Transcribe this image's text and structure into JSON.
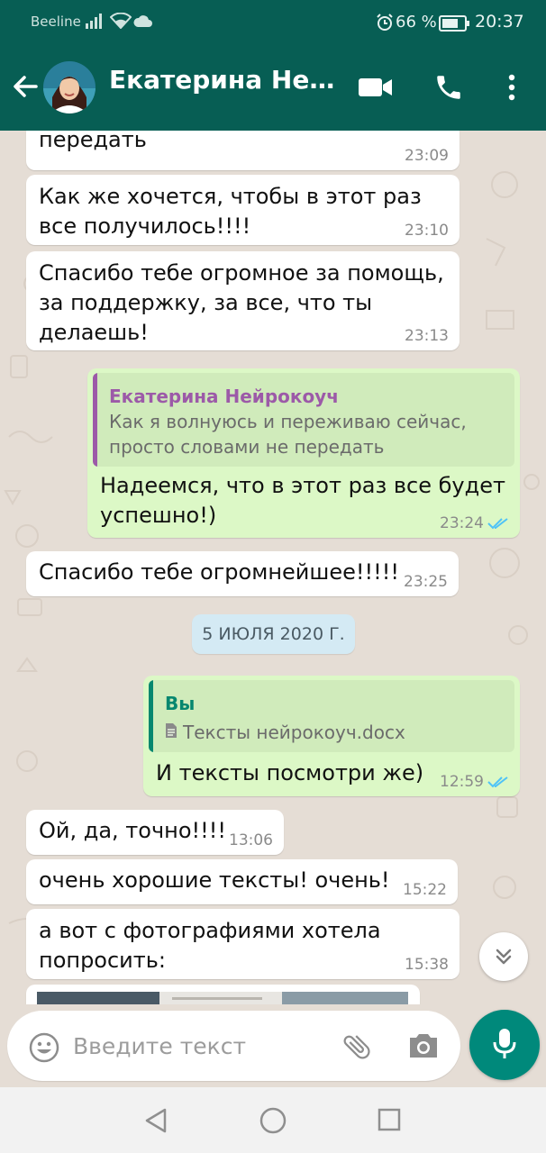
{
  "status_bar": {
    "carrier": "Beeline",
    "battery_percent": "66 %",
    "time": "20:37"
  },
  "header": {
    "contact_name": "Екатерина Нейрокоуч",
    "icons": [
      "back-arrow-icon",
      "video-call-icon",
      "phone-icon",
      "more-vert-icon"
    ]
  },
  "messages": [
    {
      "text": "передать",
      "time": "23:09",
      "direction": "in"
    },
    {
      "text": "Как же хочется, чтобы в этот раз\nвсе получилось!!!!",
      "time": "23:10",
      "direction": "in"
    },
    {
      "text": "Спасибо тебе огромное за помощь,\nза поддержку, за все, что ты\nделаешь!",
      "time": "23:13",
      "direction": "in"
    },
    {
      "direction": "out",
      "quote": {
        "author": "Екатерина Нейрокоуч",
        "text": "Как я волнуюсь и переживаю сейчас,\nпросто словами не передать",
        "color": "#9c5aa8"
      },
      "text": "Надеемся, что в этот раз все будет\nуспешно!)",
      "time": "23:24",
      "status": "read"
    },
    {
      "text": "Спасибо тебе огромнейшее!!!!!",
      "time": "23:25",
      "direction": "in"
    },
    {
      "direction": "out",
      "quote": {
        "author": "Вы",
        "text": "Тексты нейрокоуч.docx",
        "color": "#07876f",
        "icon": "document-icon"
      },
      "text": "И тексты посмотри же)",
      "time": "12:59",
      "status": "read"
    },
    {
      "text": "Ой, да, точно!!!!",
      "time": "13:06",
      "direction": "in"
    },
    {
      "text": "очень хорошие тексты! очень!",
      "time": "15:22",
      "direction": "in"
    },
    {
      "text": "а вот с фотографиями хотела\nпопросить:",
      "time": "15:38",
      "direction": "in"
    }
  ],
  "date_separator": "5 ИЮЛЯ 2020 Г.",
  "input": {
    "placeholder": "Введите текст"
  },
  "colors": {
    "header": "#075e54",
    "outgoing_bubble": "#dcf8c6",
    "incoming_bubble": "#ffffff",
    "read_ticks": "#4fc3f7",
    "mic_button": "#00897b"
  }
}
